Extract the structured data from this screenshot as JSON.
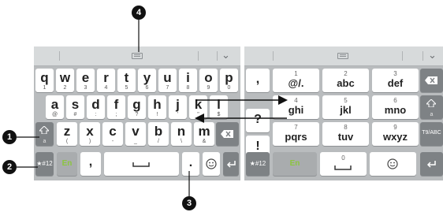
{
  "markers": {
    "one": "1",
    "two": "2",
    "three": "3",
    "four": "4"
  },
  "qwerty": {
    "row1": [
      {
        "main": "q",
        "sub": "1"
      },
      {
        "main": "w",
        "sub": "2"
      },
      {
        "main": "e",
        "sub": "3"
      },
      {
        "main": "r",
        "sub": "4"
      },
      {
        "main": "t",
        "sub": "5"
      },
      {
        "main": "y",
        "sub": "6"
      },
      {
        "main": "u",
        "sub": "7"
      },
      {
        "main": "i",
        "sub": "8"
      },
      {
        "main": "o",
        "sub": "9"
      },
      {
        "main": "p",
        "sub": "0"
      }
    ],
    "row2": [
      {
        "main": "a",
        "sub": "@"
      },
      {
        "main": "s",
        "sub": "#"
      },
      {
        "main": "d",
        "sub": ":"
      },
      {
        "main": "f",
        "sub": ";"
      },
      {
        "main": "g",
        "sub": "?"
      },
      {
        "main": "h",
        "sub": "!"
      },
      {
        "main": "j",
        "sub": "'"
      },
      {
        "main": "k",
        "sub": "\""
      },
      {
        "main": "l",
        "sub": "$"
      }
    ],
    "row3": [
      {
        "main": "z",
        "sub": "("
      },
      {
        "main": "x",
        "sub": ")"
      },
      {
        "main": "c",
        "sub": "-"
      },
      {
        "main": "v",
        "sub": "_"
      },
      {
        "main": "b",
        "sub": "/"
      },
      {
        "main": "n",
        "sub": "\\"
      },
      {
        "main": "m",
        "sub": "&"
      }
    ],
    "shift_sub": "a",
    "symbols_label": "★#12",
    "lang_label": "En",
    "comma_label": ",",
    "period_label": "."
  },
  "t9": {
    "keys": [
      {
        "num": "1",
        "letters": "@/."
      },
      {
        "num": "2",
        "letters": "abc"
      },
      {
        "num": "3",
        "letters": "def"
      },
      {
        "num": "4",
        "letters": "ghi"
      },
      {
        "num": "5",
        "letters": "jkl"
      },
      {
        "num": "6",
        "letters": "mno"
      },
      {
        "num": "7",
        "letters": "pqrs"
      },
      {
        "num": "8",
        "letters": "tuv"
      },
      {
        "num": "9",
        "letters": "wxyz"
      }
    ],
    "side": [
      ",",
      "?",
      "!"
    ],
    "symbols_label": "★#12",
    "lang_label": "En",
    "zero_label": "0",
    "switch_label": "T9/ABC",
    "shift_sub": "a"
  }
}
